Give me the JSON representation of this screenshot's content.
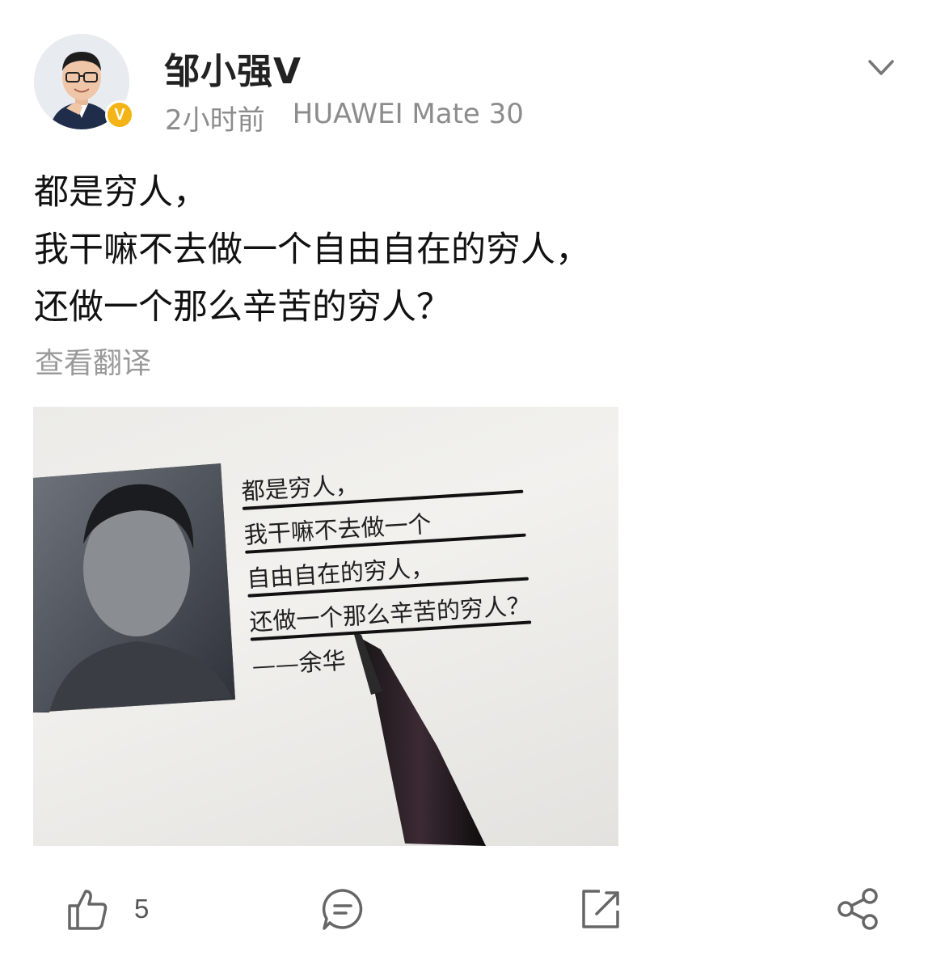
{
  "post": {
    "author": "邹小强V",
    "time": "2小时前",
    "device": "HUAWEI Mate 30",
    "verified_badge": "V",
    "text_lines": [
      "都是穷人，",
      "我干嘛不去做一个自由自在的穷人，",
      "还做一个那么辛苦的穷人？"
    ],
    "translate_label": "查看翻译",
    "image": {
      "quote_lines": [
        "都是穷人，",
        "我干嘛不去做一个",
        "自由自在的穷人，",
        "还做一个那么辛苦的穷人？",
        "——余华"
      ]
    }
  },
  "actions": {
    "like_count": "5",
    "icons": [
      "thumbs-up-icon",
      "comment-icon",
      "repost-icon",
      "share-icon"
    ]
  },
  "colors": {
    "badge": "#f4b416",
    "meta_text": "#8c8c8c",
    "icon": "#666666"
  }
}
